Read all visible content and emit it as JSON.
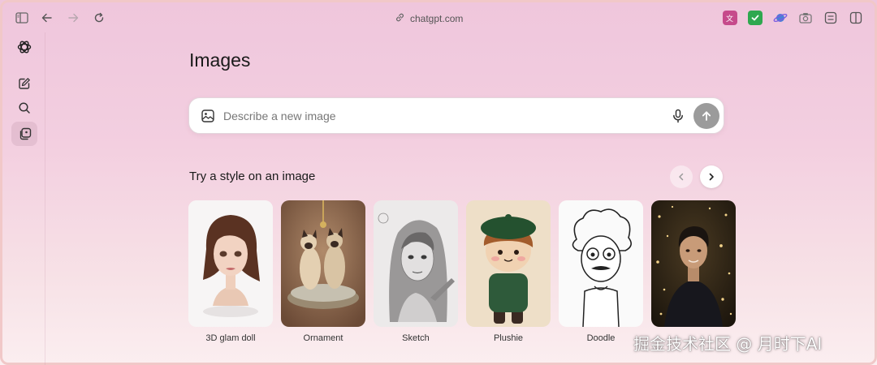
{
  "browser": {
    "url": "chatgpt.com",
    "icons": {
      "sidebar_toggle": "sidebar-toggle-icon",
      "back": "arrow-left-icon",
      "forward": "arrow-right-icon",
      "reload": "reload-icon",
      "link": "link-icon"
    },
    "extensions": [
      "translate-extension-icon",
      "checkmark-extension-icon",
      "planet-extension-icon",
      "camera-extension-icon",
      "reader-icon",
      "split-view-icon"
    ]
  },
  "sidebar": {
    "items": [
      {
        "name": "chatgpt-logo-icon"
      },
      {
        "name": "new-chat-icon"
      },
      {
        "name": "search-icon"
      },
      {
        "name": "images-icon",
        "active": true
      }
    ]
  },
  "main": {
    "title": "Images",
    "composer": {
      "placeholder": "Describe a new image"
    },
    "styles_section": {
      "title": "Try a style on an image",
      "cards": [
        {
          "label": "3D glam doll"
        },
        {
          "label": "Ornament"
        },
        {
          "label": "Sketch"
        },
        {
          "label": "Plushie"
        },
        {
          "label": "Doodle"
        },
        {
          "label": ""
        }
      ]
    }
  },
  "watermark": "掘金技术社区 @ 月时下AI",
  "colors": {
    "accent_send": "#9b9b9b",
    "background_top": "#efc6dc",
    "background_bottom": "#fbeef0"
  }
}
